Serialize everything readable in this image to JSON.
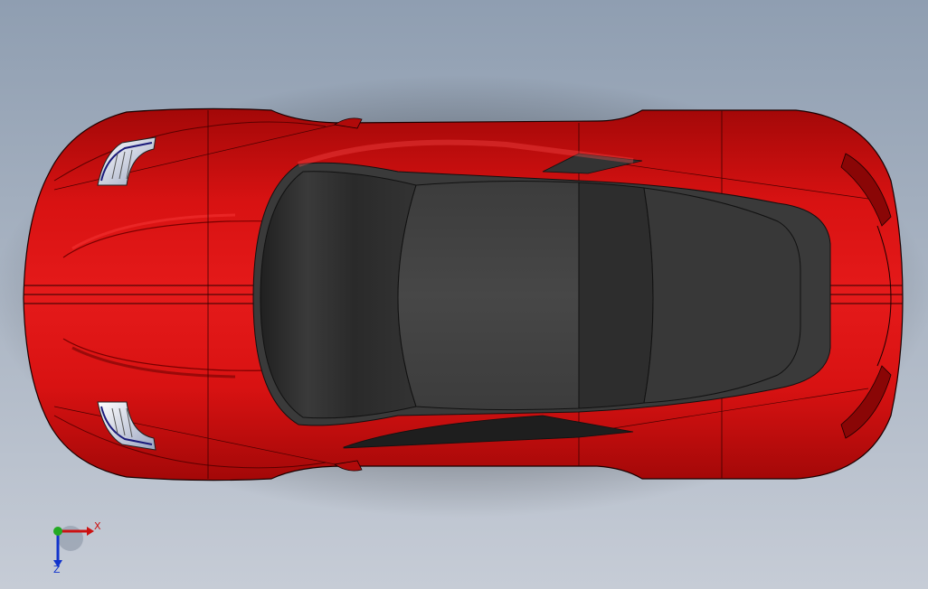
{
  "viewport": {
    "background_top": "#8f9eb1",
    "background_bottom": "#c6ccd6"
  },
  "model": {
    "body_color": "#cc0d0d",
    "body_highlight": "#e01818",
    "body_shadow": "#8a0606",
    "glass_color": "#2b2b2b",
    "glass_highlight": "#454545",
    "edge_color": "#1a0000"
  },
  "triad": {
    "x_label": "X",
    "z_label": "Z",
    "x_color": "#cc1111",
    "y_color": "#22aa22",
    "z_color": "#1133cc"
  }
}
